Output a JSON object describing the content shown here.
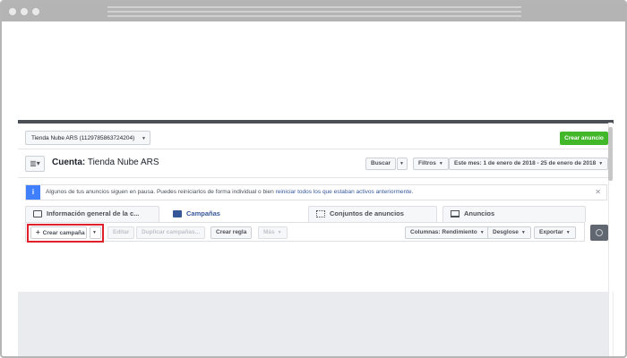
{
  "account_selector": {
    "label": "Tienda Nube ARS (1129785863724204)"
  },
  "header": {
    "create_ad_label": "Crear anuncio"
  },
  "account": {
    "prefix": "Cuenta:",
    "name": "Tienda Nube ARS"
  },
  "top_actions": {
    "search_label": "Buscar",
    "filters_label": "Filtros",
    "date_range_label": "Este mes: 1 de enero de 2018 - 25 de enero de 2018"
  },
  "notice": {
    "message": "Algunos de tus anuncios siguen en pausa. Puedes reiniciarlos de forma individual o bien",
    "link_text": "reiniciar todos los que estaban activos anteriormente",
    "suffix": "."
  },
  "tabs": [
    {
      "label": "Información general de la c...",
      "icon": "account-overview-icon"
    },
    {
      "label": "Campañas",
      "icon": "campaigns-icon",
      "active": true
    },
    {
      "label": "Conjuntos de anuncios",
      "icon": "ad-sets-icon"
    },
    {
      "label": "Anuncios",
      "icon": "ads-icon"
    }
  ],
  "toolbar": {
    "create_campaign_label": "Crear campaña",
    "edit_label": "Editar",
    "duplicate_label": "Duplicar campañas...",
    "create_rule_label": "Crear regla",
    "more_label": "Más",
    "columns_label": "Columnas: Rendimiento",
    "breakdown_label": "Desglose",
    "export_label": "Exportar"
  },
  "colors": {
    "primary_green": "#42b72a",
    "link_blue": "#365899",
    "info_blue": "#4080ff",
    "highlight_red": "#e0202a"
  }
}
